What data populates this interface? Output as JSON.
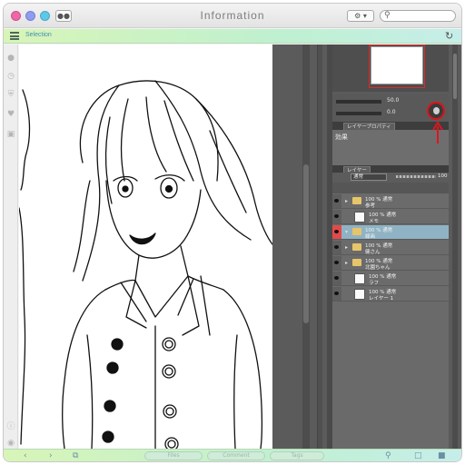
{
  "window": {
    "title": "Information",
    "chat_icon": "speech-bubble-icon",
    "settings_icon": "gear-icon",
    "search_icon": "search-icon",
    "colors": {
      "close": "#ee68a8",
      "minimize": "#8f9cf0",
      "zoom": "#5fc8e8"
    }
  },
  "selection_bar": {
    "menu_icon": "hamburger-icon",
    "label": "Selection",
    "refresh_icon": "refresh-icon",
    "color": "#c6f0c8"
  },
  "sidebar": {
    "icons": [
      "person-icon",
      "clock-icon",
      "shield-icon",
      "heart-icon",
      "card-icon",
      "info-icon",
      "globe-icon"
    ]
  },
  "app": {
    "tool_panel": {
      "value1": "50.0",
      "value2": "0.0",
      "highlight_color": "#d9141d"
    },
    "property_panel": {
      "tab": "レイヤープロパティ",
      "label": "効果"
    },
    "layer_panel": {
      "tab": "レイヤー",
      "blend_mode": "通常",
      "opacity": "100",
      "layers": [
        {
          "line1": "100 % 通常",
          "line2": "参考",
          "type": "folder",
          "selected": false
        },
        {
          "line1": "100 % 通常",
          "line2": "メモ",
          "type": "layer",
          "selected": false
        },
        {
          "line1": "100 % 通常",
          "line2": "線画",
          "type": "folder",
          "selected": true
        },
        {
          "line1": "100 % 通常",
          "line2": "健さん",
          "type": "folder",
          "selected": false
        },
        {
          "line1": "100 % 通常",
          "line2": "北園ちゃん",
          "type": "folder",
          "selected": false
        },
        {
          "line1": "100 % 通常",
          "line2": "ラフ",
          "type": "layer",
          "selected": false
        },
        {
          "line1": "100 % 通常",
          "line2": "レイヤー 1",
          "type": "layer",
          "selected": false
        }
      ]
    }
  },
  "bottom_bar": {
    "back_icon": "chevron-left-icon",
    "forward_icon": "chevron-right-icon",
    "copy_icon": "copy-icon",
    "pills": [
      "Files",
      "Comment",
      "Tags"
    ],
    "lock_icon": "lock-icon",
    "folder_icon": "folder-icon",
    "trash_icon": "trash-icon"
  }
}
